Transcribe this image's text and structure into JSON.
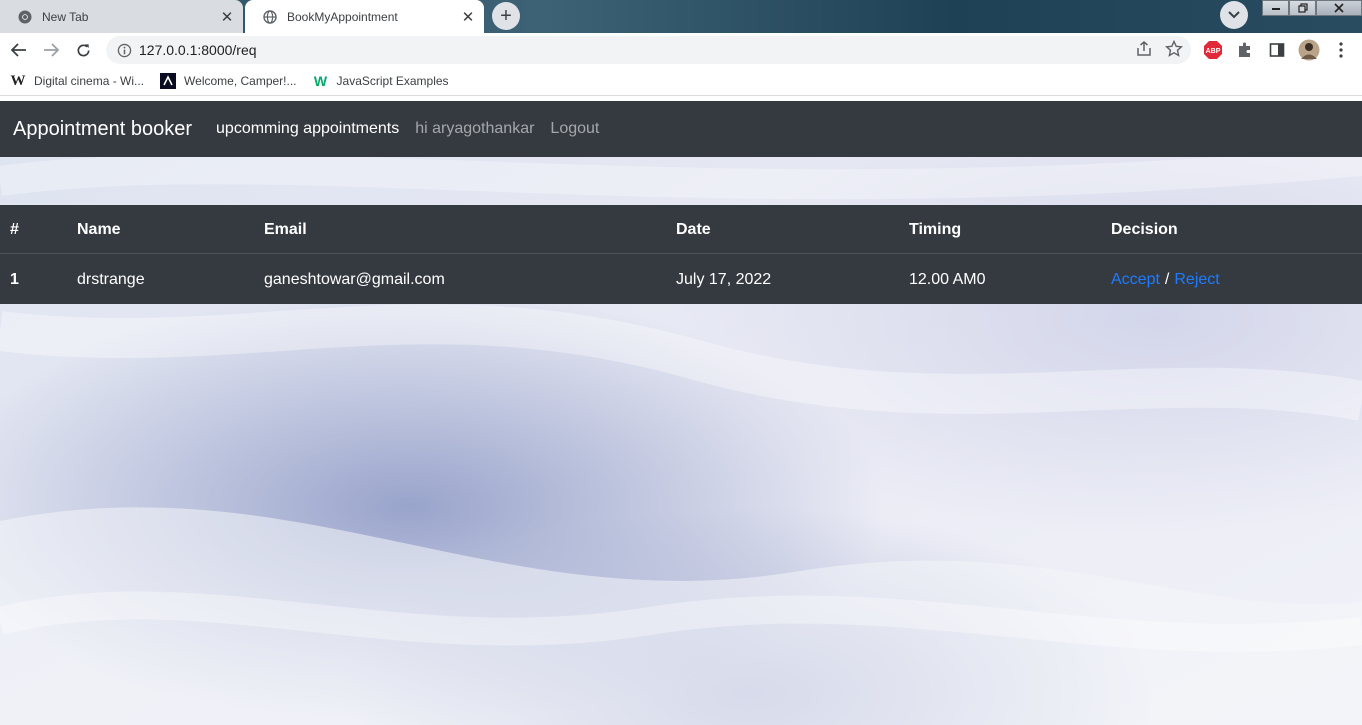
{
  "browser": {
    "tabs": [
      {
        "title": "New Tab",
        "active": false
      },
      {
        "title": "BookMyAppointment",
        "active": true
      }
    ],
    "url": "127.0.0.1:8000/req",
    "bookmarks": [
      {
        "label": "Digital cinema - Wi...",
        "icon": "wikipedia-icon"
      },
      {
        "label": "Welcome, Camper!...",
        "icon": "freecodecamp-icon"
      },
      {
        "label": "JavaScript Examples",
        "icon": "w3schools-icon"
      }
    ],
    "extensions": {
      "adblock_label": "ABP"
    }
  },
  "navbar": {
    "brand": "Appointment booker",
    "links": [
      "upcomming appointments",
      "hi aryagothankar",
      "Logout"
    ]
  },
  "table": {
    "headers": [
      "#",
      "Name",
      "Email",
      "Date",
      "Timing",
      "Decision"
    ],
    "rows": [
      {
        "index": "1",
        "name": "drstrange",
        "email": "ganeshtowar@gmail.com",
        "date": "July 17, 2022",
        "timing": "12.00 AM0",
        "accept": "Accept",
        "separator": "/",
        "reject": "Reject"
      }
    ]
  },
  "colors": {
    "navbar_bg": "#343a40",
    "link": "#1e7bff",
    "tab_strip": "#2c4f63"
  }
}
